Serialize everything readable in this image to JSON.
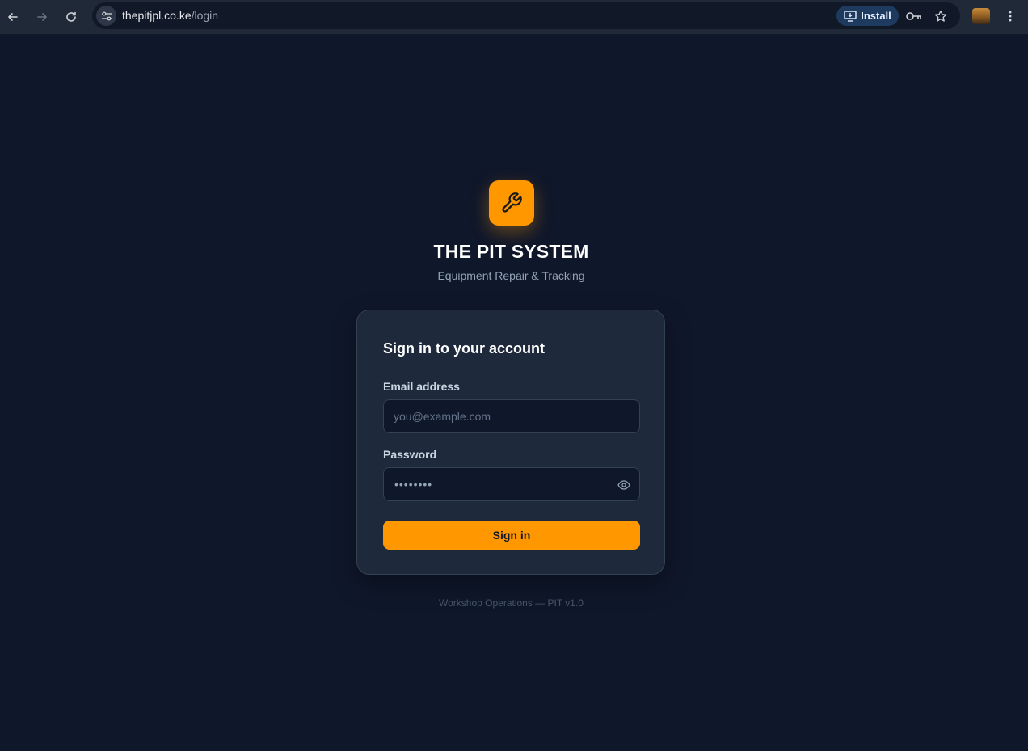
{
  "browser": {
    "url_host": "thepitjpl.co.ke",
    "url_path": "/login",
    "install_label": "Install"
  },
  "app": {
    "title": "THE PIT SYSTEM",
    "subtitle": "Equipment Repair & Tracking",
    "accent_color": "#ff9800",
    "logo_icon": "wrench-icon"
  },
  "login": {
    "heading": "Sign in to your account",
    "email_label": "Email address",
    "email_placeholder": "you@example.com",
    "email_value": "",
    "password_label": "Password",
    "password_masked": "••••••••",
    "submit_label": "Sign in"
  },
  "footer": {
    "text": "Workshop Operations — PIT v1.0"
  }
}
